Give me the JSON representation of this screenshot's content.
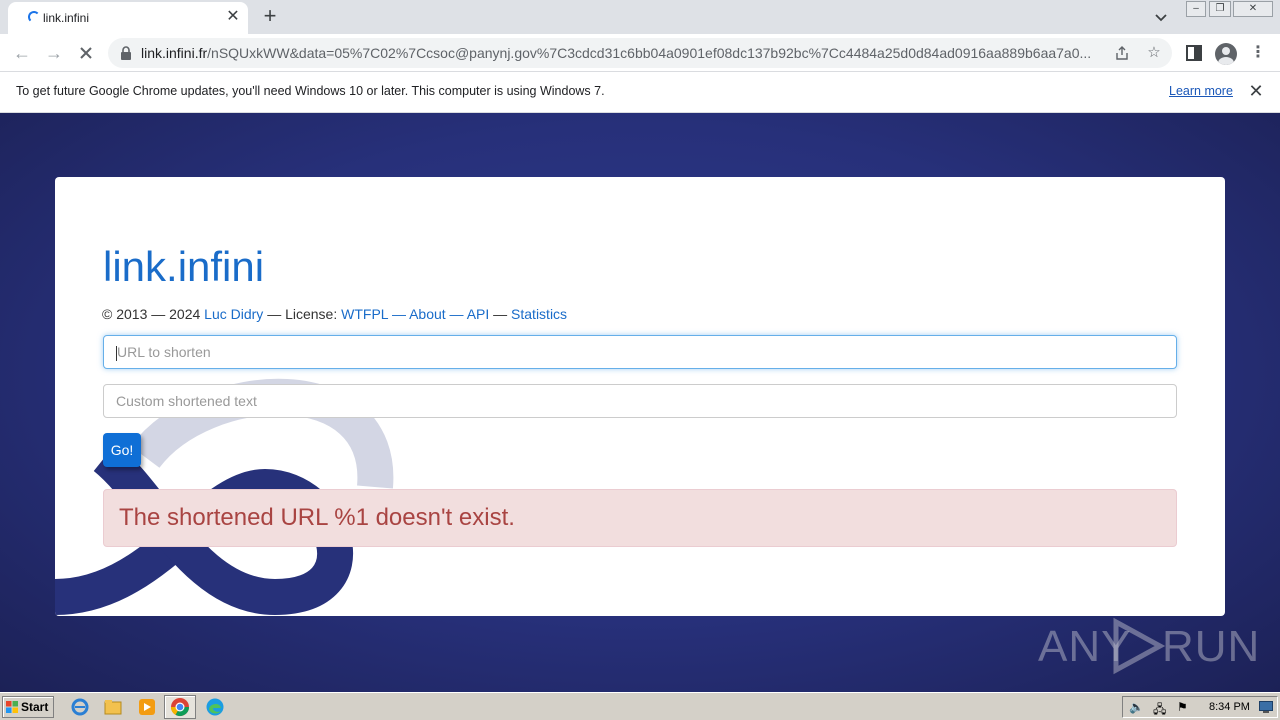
{
  "browser": {
    "tab_title": "link.infini",
    "url_domain": "link.infini.fr",
    "url_path": "/nSQUxkWW&data=05%7C02%7Ccsoc@panynj.gov%7C3cdcd31c6bb04a0901ef08dc137b92bc%7Cc4484a25d0d84ad0916aa889b6aa7a0...",
    "infobar_text": "To get future Google Chrome updates, you'll need Windows 10 or later. This computer is using Windows 7.",
    "infobar_link": "Learn more"
  },
  "page": {
    "title": "link.infini",
    "credits": {
      "prefix": "© 2013 — 2024 ",
      "author": "Luc Didry",
      "license_label": " — License: ",
      "license": "WTFPL",
      "sep1": " — ",
      "about": "About",
      "sep2": " — ",
      "api": "API",
      "sep3": " — ",
      "statistics": "Statistics"
    },
    "url_input_placeholder": "URL to shorten",
    "custom_input_placeholder": "Custom shortened text",
    "go_label": "Go!",
    "error_message": "The shortened URL %1 doesn't exist."
  },
  "watermark": {
    "left": "ANY",
    "right": "RUN"
  },
  "taskbar": {
    "start_label": "Start",
    "clock": "8:34 PM",
    "icons": [
      "ie-icon",
      "explorer-icon",
      "media-player-icon",
      "chrome-icon",
      "edge-icon"
    ]
  },
  "colors": {
    "link": "#1a6cc9",
    "go_button": "#0f6fd6",
    "alert_bg": "#f2dede",
    "alert_text": "#a94442",
    "page_bg": "#2a3470"
  }
}
